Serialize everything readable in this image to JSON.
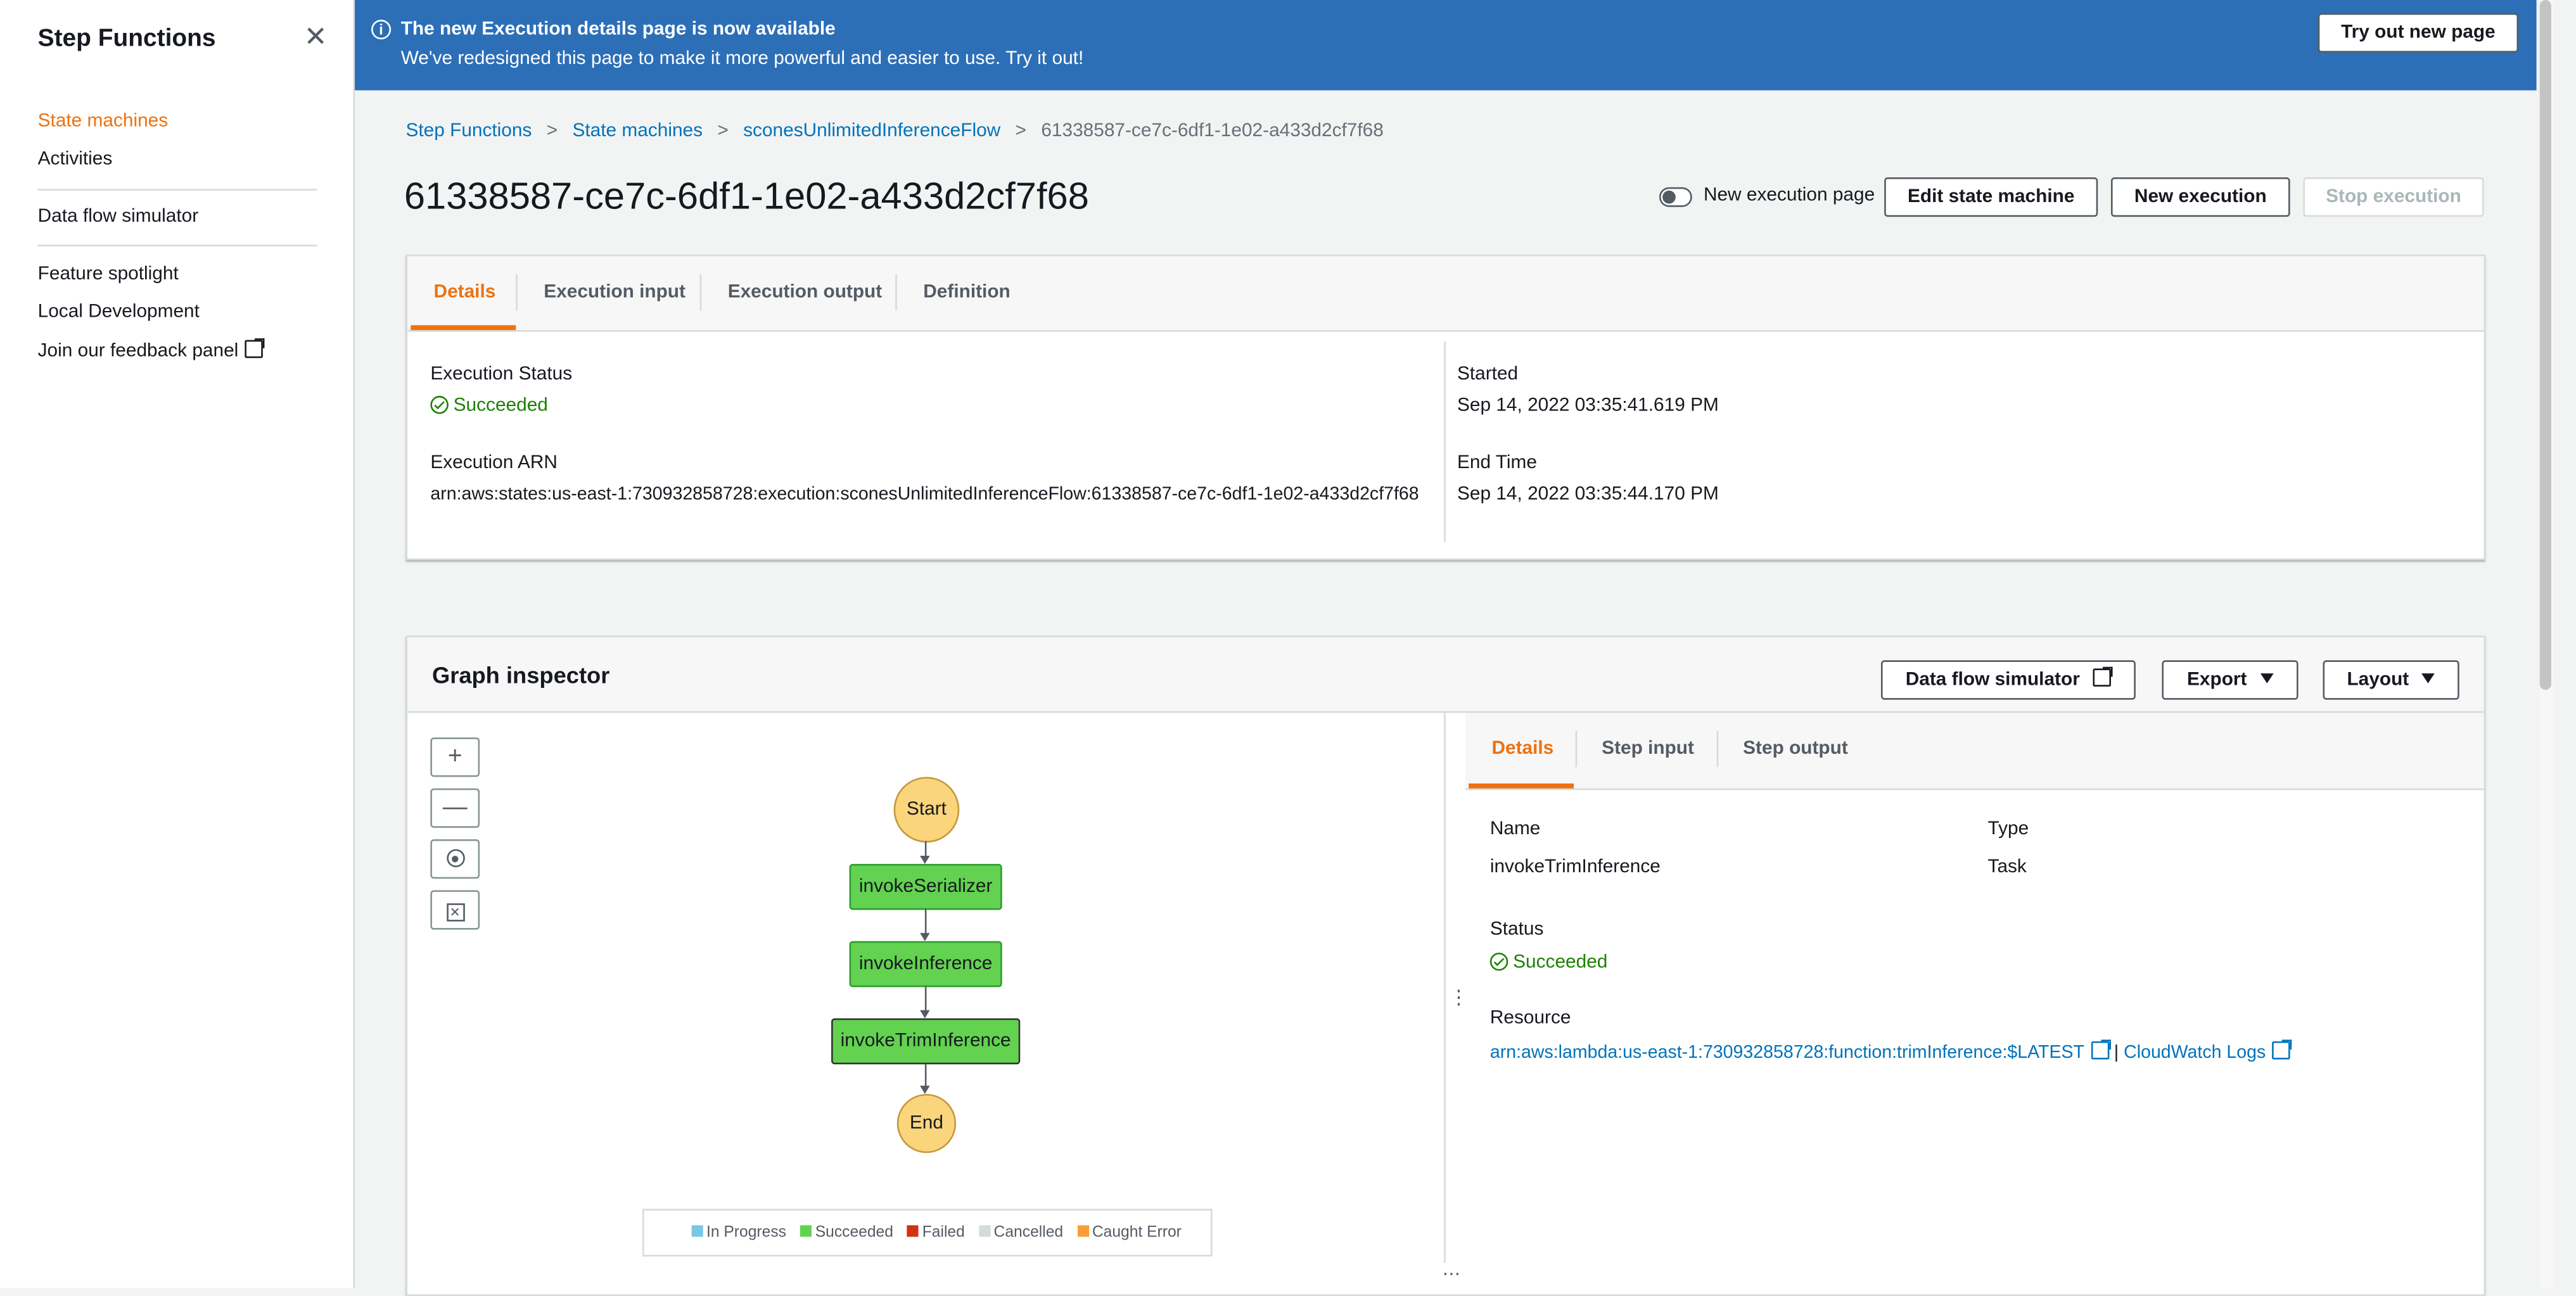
{
  "sidebar": {
    "title": "Step Functions",
    "items": [
      {
        "label": "State machines",
        "active": true
      },
      {
        "label": "Activities"
      },
      {
        "label": "Data flow simulator"
      },
      {
        "label": "Feature spotlight"
      },
      {
        "label": "Local Development"
      },
      {
        "label": "Join our feedback panel"
      }
    ]
  },
  "banner": {
    "title": "The new Execution details page is now available",
    "text": "We've redesigned this page to make it more powerful and easier to use. Try it out!",
    "button": "Try out new page"
  },
  "breadcrumb": [
    "Step Functions",
    "State machines",
    "sconesUnlimitedInferenceFlow",
    "61338587-ce7c-6df1-1e02-a433d2cf7f68"
  ],
  "header": {
    "title": "61338587-ce7c-6df1-1e02-a433d2cf7f68",
    "toggle_label": "New execution page",
    "toggle_on": false,
    "buttons": {
      "edit": "Edit state machine",
      "new": "New execution",
      "stop": "Stop execution"
    }
  },
  "details_panel": {
    "tabs": [
      "Details",
      "Execution input",
      "Execution output",
      "Definition"
    ],
    "active_tab": "Details",
    "execution_status_label": "Execution Status",
    "execution_status": "Succeeded",
    "execution_arn_label": "Execution ARN",
    "execution_arn": "arn:aws:states:us-east-1:730932858728:execution:sconesUnlimitedInferenceFlow:61338587-ce7c-6df1-1e02-a433d2cf7f68",
    "started_label": "Started",
    "started": "Sep 14, 2022 03:35:41.619 PM",
    "end_time_label": "End Time",
    "end_time": "Sep 14, 2022 03:35:44.170 PM"
  },
  "graph_inspector": {
    "title": "Graph inspector",
    "buttons": {
      "simulator": "Data flow simulator",
      "export": "Export",
      "layout": "Layout"
    },
    "zoom_controls": {
      "zoom_in": "+",
      "zoom_out": "—"
    },
    "nodes": {
      "start": "Start",
      "serializer": "invokeSerializer",
      "inference": "invokeInference",
      "trim": "invokeTrimInference",
      "end": "End"
    },
    "legend": [
      {
        "label": "In Progress",
        "color": "#79c7e3"
      },
      {
        "label": "Succeeded",
        "color": "#62d250"
      },
      {
        "label": "Failed",
        "color": "#d13212"
      },
      {
        "label": "Cancelled",
        "color": "#d5dbdb"
      },
      {
        "label": "Caught Error",
        "color": "#f89e3a"
      }
    ],
    "step": {
      "tabs": [
        "Details",
        "Step input",
        "Step output"
      ],
      "active_tab": "Details",
      "name_label": "Name",
      "name": "invokeTrimInference",
      "type_label": "Type",
      "type": "Task",
      "status_label": "Status",
      "status": "Succeeded",
      "resource_label": "Resource",
      "resource_link": "arn:aws:lambda:us-east-1:730932858728:function:trimInference:$LATEST",
      "separator": "|",
      "logs_link": "CloudWatch Logs"
    }
  },
  "colors": {
    "accent": "#ec7211",
    "link": "#0073bb",
    "success": "#1d8102",
    "banner": "#2c6fb7"
  }
}
